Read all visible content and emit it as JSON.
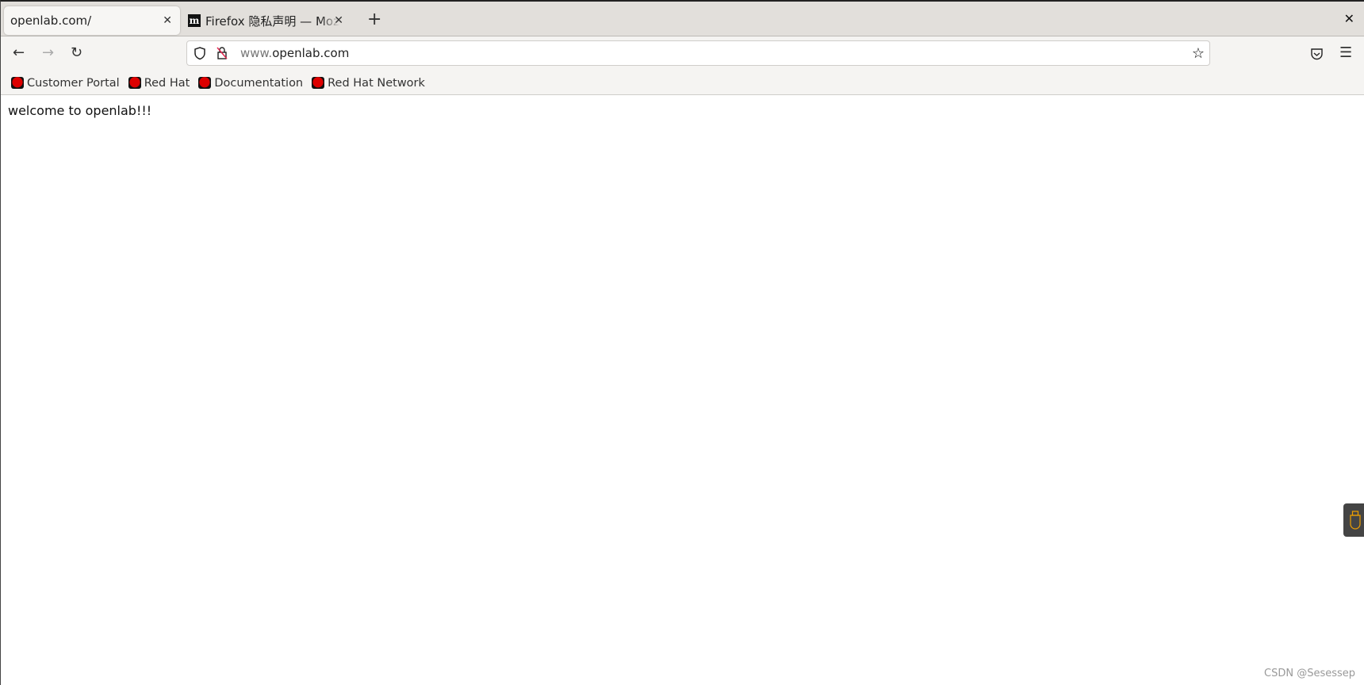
{
  "tabs": [
    {
      "label": "openlab.com/",
      "active": true
    },
    {
      "label": "Firefox 隐私声明 — Mozilla",
      "favicon": "m"
    }
  ],
  "nav": {
    "url_prefix": "www.",
    "url_host": "openlab.com"
  },
  "bookmarks": [
    {
      "label": "Customer Portal"
    },
    {
      "label": "Red Hat"
    },
    {
      "label": "Documentation"
    },
    {
      "label": "Red Hat Network"
    }
  ],
  "page": {
    "text": "welcome to openlab!!!"
  },
  "watermark": "CSDN @Sesessep",
  "colors": {
    "usb_icon": "#f0a000",
    "redhat": "#cc0000"
  }
}
